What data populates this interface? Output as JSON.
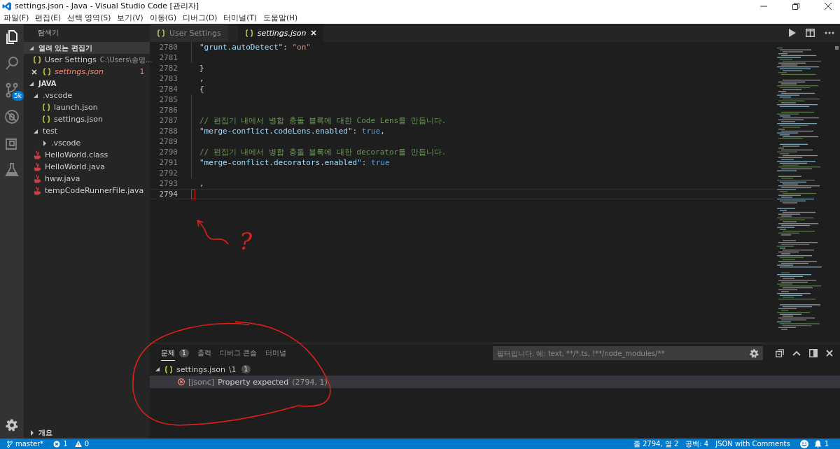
{
  "window": {
    "title": "settings.json - Java - Visual Studio Code [관리자]"
  },
  "menu": [
    "파일(F)",
    "편집(E)",
    "선택 영역(S)",
    "보기(V)",
    "이동(G)",
    "디버그(D)",
    "터미널(T)",
    "도움말(H)"
  ],
  "activity_bar": [
    {
      "kind": "files",
      "selected": true
    },
    {
      "kind": "search",
      "selected": false
    },
    {
      "kind": "scm",
      "selected": false,
      "badge": "5k"
    },
    {
      "kind": "debug",
      "selected": false
    },
    {
      "kind": "extensions",
      "selected": false
    },
    {
      "kind": "test",
      "selected": false
    }
  ],
  "explorer": {
    "title": "탐색기",
    "sections": [
      {
        "title": "열려 있는 편집기",
        "kind": "open-editors",
        "expanded": true,
        "items": [
          {
            "label": "User Settings",
            "description": "C:\\Users\\송명...",
            "error": false,
            "close_shown": false
          },
          {
            "label": "settings.json",
            "error": true,
            "close_shown": true,
            "badge": "1"
          }
        ]
      },
      {
        "title": "JAVA",
        "kind": "tree",
        "expanded": true,
        "items": [
          {
            "label": ".vscode",
            "kind": "folder",
            "expanded": true,
            "children": [
              {
                "label": "launch.json",
                "kind": "json"
              },
              {
                "label": "settings.json",
                "kind": "json"
              }
            ]
          },
          {
            "label": "test",
            "kind": "folder",
            "expanded": true,
            "children": [
              {
                "label": ".vscode",
                "kind": "folder",
                "expanded": false
              }
            ]
          },
          {
            "label": "HelloWorld.class",
            "kind": "java"
          },
          {
            "label": "HelloWorld.java",
            "kind": "java"
          },
          {
            "label": "hww.java",
            "kind": "java"
          },
          {
            "label": "tempCodeRunnerFile.java",
            "kind": "java"
          }
        ]
      },
      {
        "title": "개요",
        "kind": "outline",
        "expanded": false
      }
    ]
  },
  "editor": {
    "tabs": [
      {
        "label": "User Settings",
        "selected": false
      },
      {
        "label": "settings.json",
        "selected": true
      }
    ],
    "lines": [
      {
        "number": "2780",
        "indented": true,
        "current": false,
        "tokens": [
          {
            "kind": "key",
            "text": "\"grunt.autoDetect\""
          },
          {
            "kind": "punct",
            "text": ": "
          },
          {
            "kind": "string",
            "text": "\"on\""
          }
        ]
      },
      {
        "number": "2781",
        "indented": true,
        "current": false
      },
      {
        "number": "2782",
        "indented": false,
        "current": false,
        "tokens": [
          {
            "kind": "punct",
            "text": "}"
          }
        ]
      },
      {
        "number": "2783",
        "indented": false,
        "current": false,
        "tokens": [
          {
            "kind": "punct",
            "text": ","
          }
        ]
      },
      {
        "number": "2784",
        "indented": false,
        "current": false,
        "tokens": [
          {
            "kind": "punct",
            "text": "{"
          }
        ]
      },
      {
        "number": "2785",
        "indented": true,
        "current": false
      },
      {
        "number": "2786",
        "indented": true,
        "current": false
      },
      {
        "number": "2787",
        "indented": true,
        "current": false,
        "tokens": [
          {
            "kind": "comment",
            "text": "// 편집기 내에서 병합 충돌 블록에 대한 Code Lens를 만듭니다."
          }
        ]
      },
      {
        "number": "2788",
        "indented": true,
        "current": false,
        "tokens": [
          {
            "kind": "key",
            "text": "\"merge-conflict.codeLens.enabled\""
          },
          {
            "kind": "punct",
            "text": ": "
          },
          {
            "kind": "bool",
            "text": "true"
          },
          {
            "kind": "punct",
            "text": ","
          }
        ]
      },
      {
        "number": "2789",
        "indented": true,
        "current": false
      },
      {
        "number": "2790",
        "indented": true,
        "current": false,
        "tokens": [
          {
            "kind": "comment",
            "text": "// 편집기 내에서 병합 충돌 블록에 대한 decorator를 만듭니다."
          }
        ]
      },
      {
        "number": "2791",
        "indented": true,
        "current": false,
        "tokens": [
          {
            "kind": "key",
            "text": "\"merge-conflict.decorators.enabled\""
          },
          {
            "kind": "punct",
            "text": ": "
          },
          {
            "kind": "bool",
            "text": "true"
          }
        ]
      },
      {
        "number": "2792",
        "indented": true,
        "current": false
      },
      {
        "number": "2793",
        "indented": false,
        "current": false,
        "tokens": [
          {
            "kind": "punct",
            "text": ","
          }
        ]
      },
      {
        "number": "2794",
        "indented": false,
        "current": true
      }
    ]
  },
  "panel": {
    "tabs": [
      {
        "label": "문제",
        "selected": true,
        "badge": "1"
      },
      {
        "label": "출력",
        "selected": false
      },
      {
        "label": "디버그 콘솔",
        "selected": false
      },
      {
        "label": "터미널",
        "selected": false
      }
    ],
    "filter": {
      "placeholder": "필터입니다. 예: text, **/*.ts, !**/node_modules/**"
    },
    "problems": [
      {
        "file": "settings.json",
        "path": "\\1",
        "count": "1",
        "expanded": true,
        "items": [
          {
            "source": "[jsonc]",
            "message": "Property expected",
            "location": "(2794, 1)",
            "selected": true
          }
        ]
      }
    ]
  },
  "status_bar": {
    "branch": "master*",
    "errors": "1",
    "warnings": "0",
    "position": "줄 2794, 열 2",
    "indent": "공백: 4",
    "language": "JSON with Comments",
    "notifications": "1"
  },
  "annotations": [
    {
      "kind": "arrow"
    },
    {
      "kind": "text",
      "text": "?"
    },
    {
      "kind": "ellipse"
    }
  ]
}
